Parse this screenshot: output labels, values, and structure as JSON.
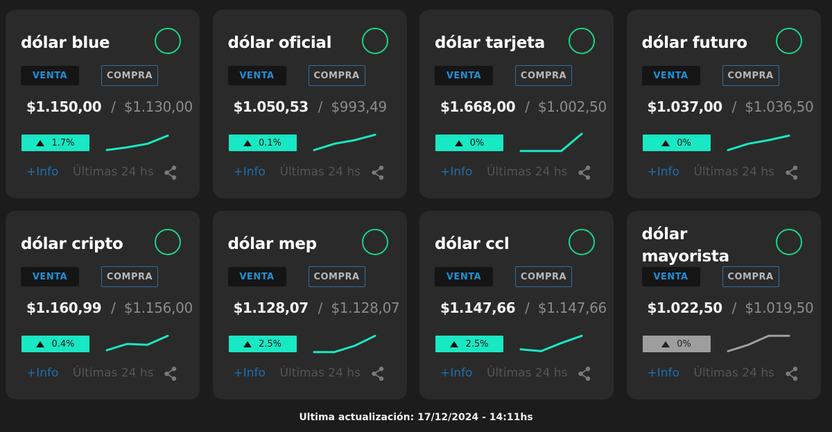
{
  "labels": {
    "venta": "VENTA",
    "compra": "COMPRA",
    "more_info": "+Info",
    "period": "Últimas 24 hs",
    "separator": "/"
  },
  "colors": {
    "accent": "#19e8c4",
    "status_green": "#1ad58b",
    "link_blue": "#1f6eb0",
    "neutral": "#9e9e9e"
  },
  "cards": [
    {
      "title": "dólar blue",
      "venta": "$1.150,00",
      "compra": "$1.130,00",
      "change": "1.7%",
      "direction": "up",
      "trend": [
        0.1,
        0.25,
        0.45,
        0.9
      ],
      "neutral": false
    },
    {
      "title": "dólar oficial",
      "venta": "$1.050,53",
      "compra": "$993,49",
      "change": "0.1%",
      "direction": "up",
      "trend": [
        0.1,
        0.45,
        0.65,
        0.95
      ],
      "neutral": false
    },
    {
      "title": "dólar tarjeta",
      "venta": "$1.668,00",
      "compra": "$1.002,50",
      "change": "0%",
      "direction": "up",
      "trend": [
        0.05,
        0.05,
        0.05,
        1.0
      ],
      "neutral": false
    },
    {
      "title": "dólar futuro",
      "venta": "$1.037,00",
      "compra": "$1.036,50",
      "change": "0%",
      "direction": "up",
      "trend": [
        0.1,
        0.45,
        0.65,
        0.9
      ],
      "neutral": false
    },
    {
      "title": "dólar cripto",
      "venta": "$1.160,99",
      "compra": "$1.156,00",
      "change": "0.4%",
      "direction": "up",
      "trend": [
        0.15,
        0.5,
        0.45,
        0.95
      ],
      "neutral": false
    },
    {
      "title": "dólar mep",
      "venta": "$1.128,07",
      "compra": "$1.128,07",
      "change": "2.5%",
      "direction": "up",
      "trend": [
        0.05,
        0.05,
        0.4,
        0.95
      ],
      "neutral": false
    },
    {
      "title": "dólar ccl",
      "venta": "$1.147,66",
      "compra": "$1.147,66",
      "change": "2.5%",
      "direction": "up",
      "trend": [
        0.2,
        0.1,
        0.55,
        0.95
      ],
      "neutral": false
    },
    {
      "title": "dólar mayorista",
      "venta": "$1.022,50",
      "compra": "$1.019,50",
      "change": "0%",
      "direction": "up",
      "trend": [
        0.1,
        0.45,
        0.95,
        0.95
      ],
      "neutral": true
    }
  ],
  "footer": {
    "last_update": "Ultima actualización: 17/12/2024 - 14:11hs"
  }
}
